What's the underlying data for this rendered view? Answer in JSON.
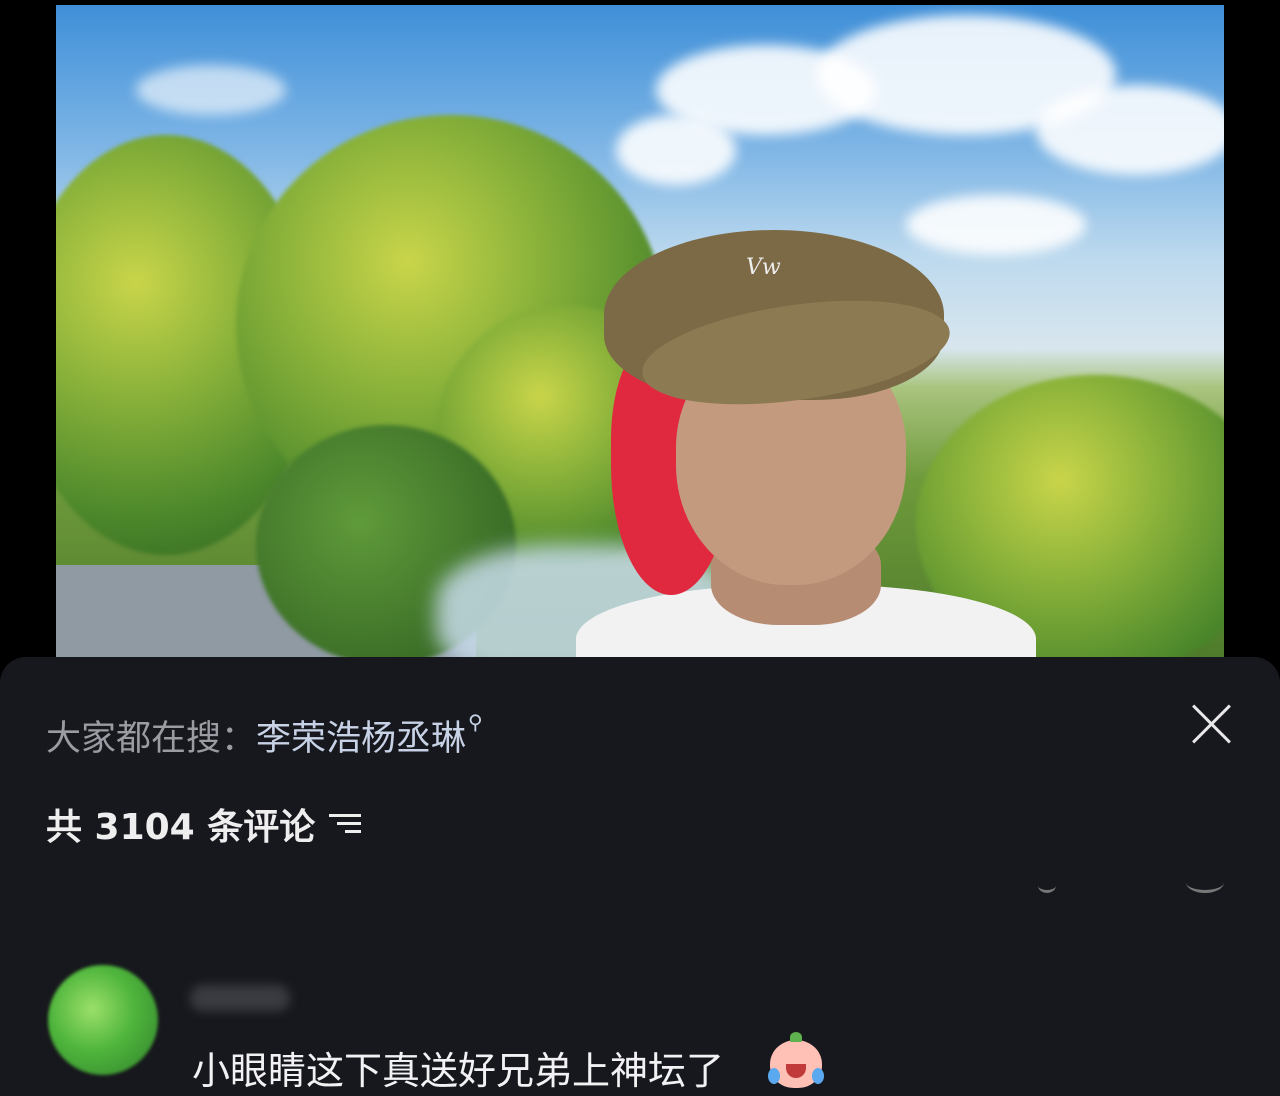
{
  "photo": {
    "cap_logo_text": "Vw"
  },
  "sheet": {
    "search_prefix": "大家都在搜：",
    "search_term": "李荣浩杨丞琳",
    "search_icon": "search-icon",
    "comment_count_text": "共 3104 条评论",
    "close_icon": "close-icon",
    "filter_icon": "filter-icon"
  },
  "comment": {
    "avatar_icon": "avatar",
    "text": "小眼睛这下真送好兄弟上神坛了",
    "emoji_icon": "crying-peach-emoji-icon"
  }
}
